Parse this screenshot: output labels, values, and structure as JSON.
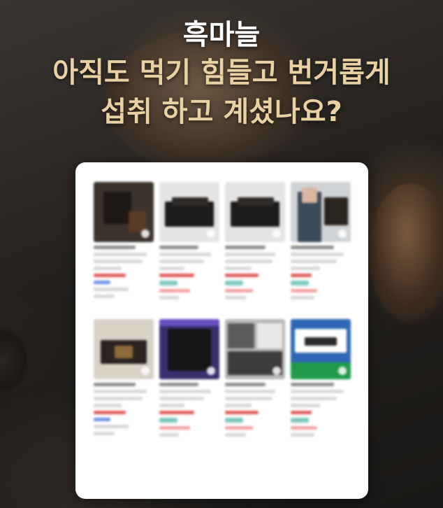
{
  "headline": {
    "brand": "흑마늘",
    "line1": "아직도 먹기 힘들고 번거롭게",
    "line2": "섭취 하고 계셨나요?"
  },
  "colors": {
    "background": "#24211e",
    "brand_text": "#ffffff",
    "headline_text": "#e8d1a3",
    "card": "#ffffff",
    "price_red": "#e05a5a",
    "link_blue": "#6b92e6"
  },
  "product_grid": {
    "blurred": true,
    "items": [
      {
        "thumb_theme": "dark-brown-box"
      },
      {
        "thumb_theme": "black-gift-box"
      },
      {
        "thumb_theme": "black-gift-box"
      },
      {
        "thumb_theme": "person-with-product"
      },
      {
        "thumb_theme": "light-room-box"
      },
      {
        "thumb_theme": "purple-dark-box"
      },
      {
        "thumb_theme": "gray-collage"
      },
      {
        "thumb_theme": "green-blue-banner"
      }
    ]
  }
}
